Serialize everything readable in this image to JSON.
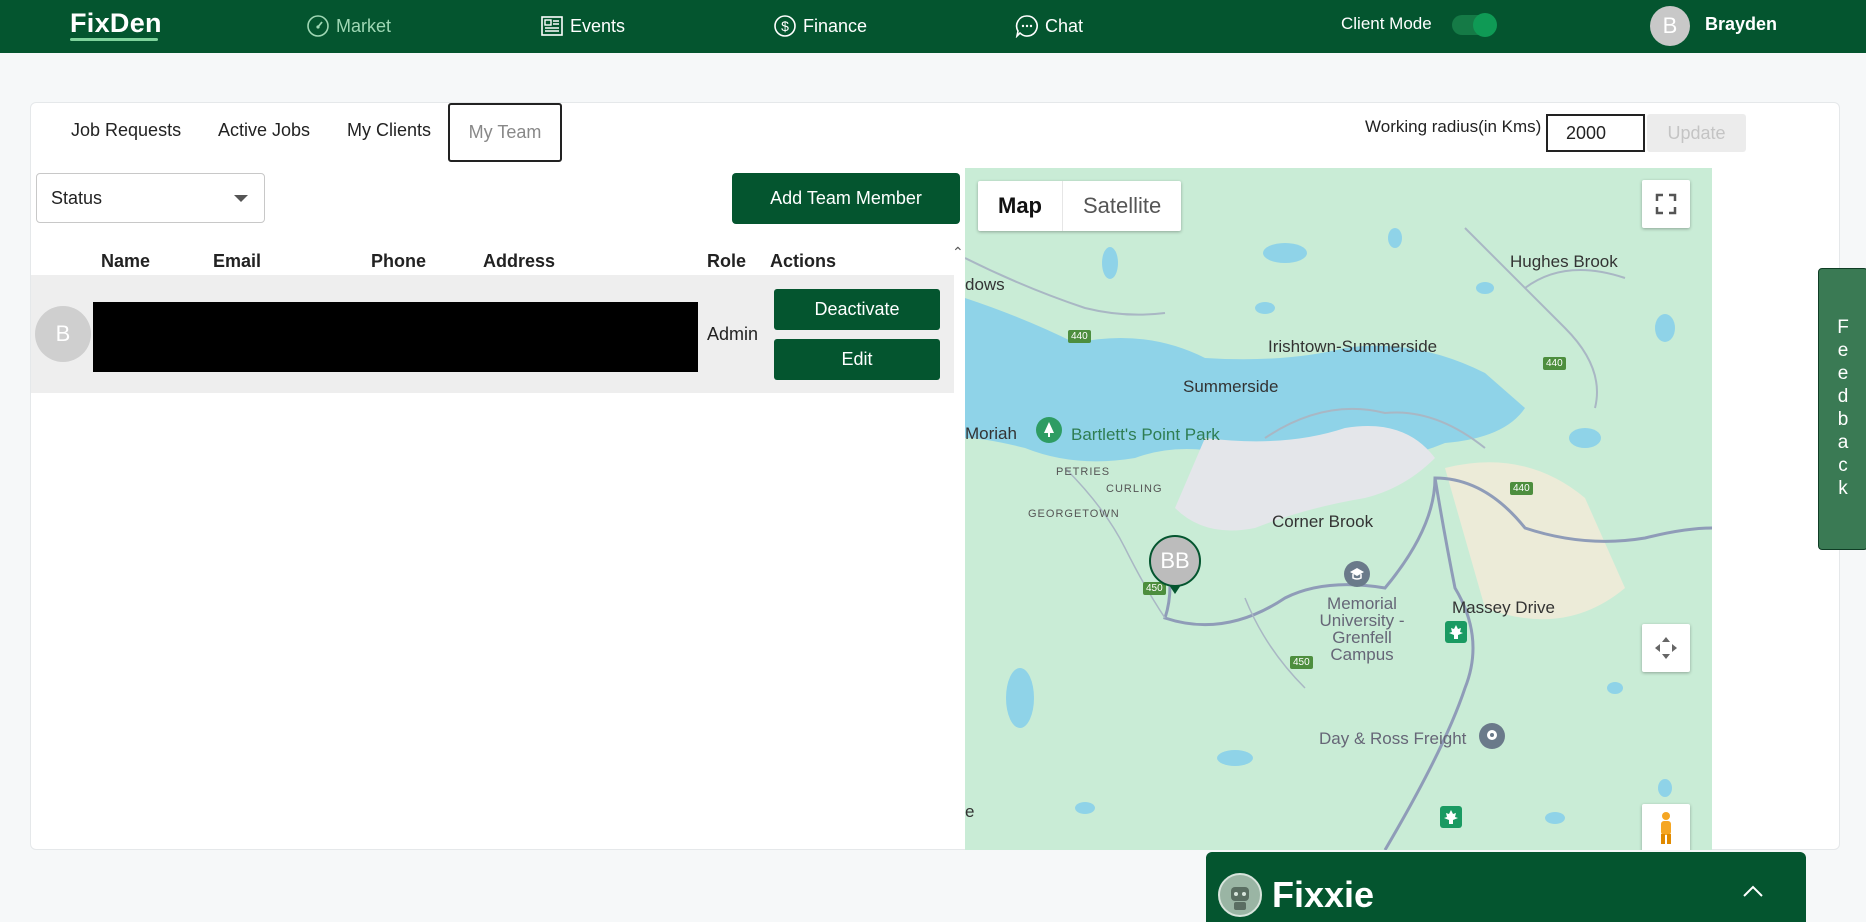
{
  "app": {
    "logo": "FixDen",
    "nav": [
      {
        "label": "Market",
        "icon": "speedometer-icon"
      },
      {
        "label": "Events",
        "icon": "newspaper-icon"
      },
      {
        "label": "Finance",
        "icon": "dollar-icon"
      },
      {
        "label": "Chat",
        "icon": "chat-bubble-icon"
      }
    ],
    "client_mode_label": "Client Mode",
    "client_mode_on": true,
    "user": {
      "initial": "B",
      "name": "Brayden"
    }
  },
  "tabs": [
    "Job Requests",
    "Active Jobs",
    "My Clients",
    "My Team"
  ],
  "active_tab": "My Team",
  "radius": {
    "label": "Working radius(in Kms)",
    "value": "2000",
    "update_label": "Update"
  },
  "filters": {
    "status_placeholder": "Status"
  },
  "add_member_label": "Add Team Member",
  "table": {
    "headers": [
      "Name",
      "Email",
      "Phone",
      "Address",
      "Role",
      "Actions"
    ],
    "rows": [
      {
        "initial": "B",
        "role": "Admin",
        "actions": [
          "Deactivate",
          "Edit"
        ]
      }
    ]
  },
  "map": {
    "types": [
      "Map",
      "Satellite"
    ],
    "selected_type": "Map",
    "pin_label": "BB",
    "labels": {
      "hughes_brook": "Hughes Brook",
      "meadows_partial": "dows",
      "irishtown": "Irishtown-Summerside",
      "summerside": "Summerside",
      "moriah": "Moriah",
      "bartletts": "Bartlett's Point Park",
      "petries": "PETRIES",
      "curling": "CURLING",
      "georgetown": "GEORGETOWN",
      "corner_brook": "Corner Brook",
      "massey_drive": "Massey Drive",
      "memorial": "Memorial University - Grenfell Campus",
      "day_ross": "Day & Ross Freight",
      "edge_e": "e"
    },
    "shields": [
      "440",
      "440",
      "440",
      "450",
      "450"
    ]
  },
  "feedback_label": "Feedback",
  "assistant": {
    "title": "Fixxie"
  },
  "colors": {
    "brand": "#04552f",
    "accent": "#7fd39c",
    "water": "#8fd3e8",
    "land": "#c9ecd6"
  }
}
